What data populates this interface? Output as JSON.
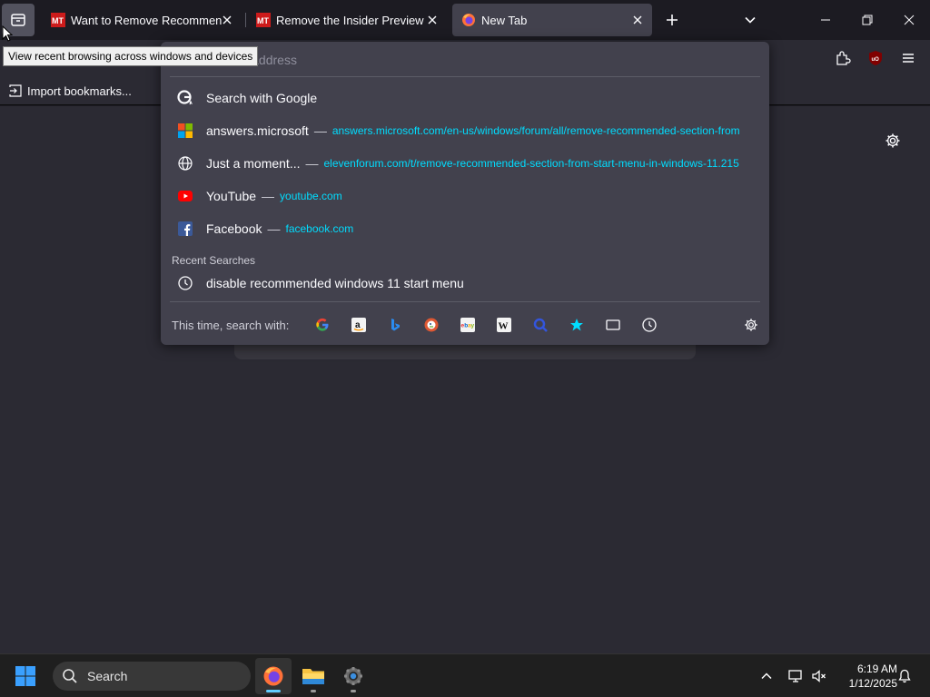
{
  "tabs": [
    {
      "title": "Want to Remove Recommended Section from Start Menu",
      "favicon": "mt-favicon"
    },
    {
      "title": "Remove the Insider Preview Evaluation Copy",
      "favicon": "mt-favicon"
    },
    {
      "title": "New Tab",
      "favicon": "firefox-icon"
    }
  ],
  "tooltip": "View recent browsing across windows and devices",
  "urlbar": {
    "placeholder": "Search or enter address",
    "visible_text": "or enter address"
  },
  "bookmarks": {
    "import_label": "Import bookmarks..."
  },
  "results": [
    {
      "icon": "google-icon",
      "title": "Search with Google",
      "sep": "",
      "url": ""
    },
    {
      "icon": "microsoft-icon",
      "title": "answers.microsoft",
      "sep": "—",
      "url": "answers.microsoft.com/en-us/windows/forum/all/remove-recommended-section-from"
    },
    {
      "icon": "globe-icon",
      "title": "Just a moment...",
      "sep": "—",
      "url": "elevenforum.com/t/remove-recommended-section-from-start-menu-in-windows-11.215"
    },
    {
      "icon": "youtube-icon",
      "title": "YouTube",
      "sep": "—",
      "url": "youtube.com"
    },
    {
      "icon": "facebook-icon",
      "title": "Facebook",
      "sep": "—",
      "url": "facebook.com"
    }
  ],
  "recent_searches": {
    "heading": "Recent Searches",
    "items": [
      {
        "icon": "clock-icon",
        "text": "disable recommended windows 11 start menu"
      }
    ]
  },
  "search_with": {
    "label": "This time, search with:",
    "engines": [
      "google-icon",
      "amazon-icon",
      "bing-icon",
      "duckduckgo-icon",
      "ebay-icon",
      "wikipedia-icon",
      "perplexity-icon",
      "bookmarks-star-icon",
      "tabs-icon",
      "history-icon"
    ]
  },
  "taskbar": {
    "search_label": "Search",
    "time": "6:19 AM",
    "date": "1/12/2025"
  },
  "colors": {
    "accent": "#00ddff",
    "panel": "#42414d",
    "toolbar": "#2b2a33",
    "tab_active": "#42414d"
  }
}
